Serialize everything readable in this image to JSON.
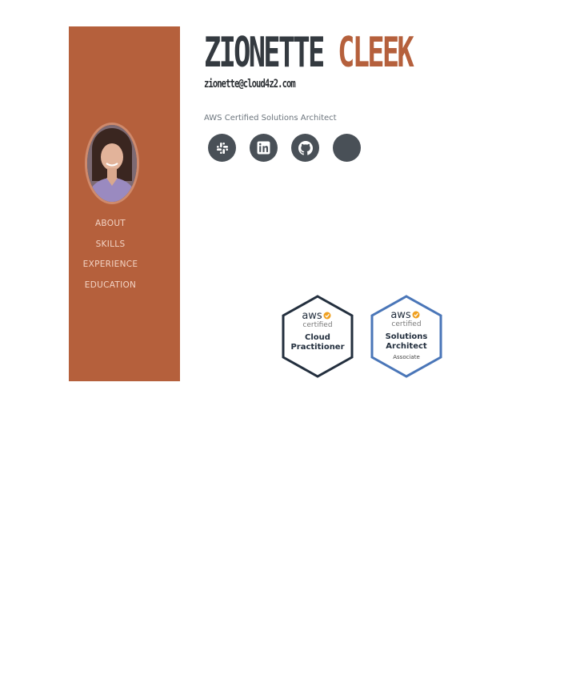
{
  "profile": {
    "first_name": "ZIONETTE",
    "last_name": "CLEEK",
    "email": "zionette@cloud4z2.com",
    "subtitle": "AWS Certified Solutions Architect"
  },
  "nav": {
    "items": [
      {
        "label": "ABOUT"
      },
      {
        "label": "SKILLS"
      },
      {
        "label": "EXPERIENCE"
      },
      {
        "label": "EDUCATION"
      }
    ]
  },
  "social": [
    {
      "icon": "slack-icon"
    },
    {
      "icon": "linkedin-icon"
    },
    {
      "icon": "github-icon"
    },
    {
      "icon": "blank-icon"
    }
  ],
  "badges": [
    {
      "brand": "aws",
      "certified": "certified",
      "line1": "Cloud",
      "line2": "Practitioner",
      "level": "",
      "border_color": "#232f3e"
    },
    {
      "brand": "aws",
      "certified": "certified",
      "line1": "Solutions",
      "line2": "Architect",
      "level": "Associate",
      "border_color": "#4a76b8"
    }
  ],
  "colors": {
    "accent": "#b5603c",
    "dark": "#343a40",
    "icon_bg": "#495057",
    "aws_check": "#f0a020"
  }
}
